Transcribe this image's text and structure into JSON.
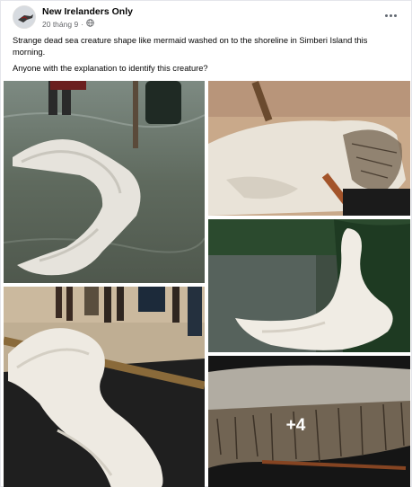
{
  "post": {
    "page_name": "New Irelanders Only",
    "date": "20 tháng 9",
    "separator": "·",
    "privacy_icon": "globe-icon",
    "more_icon": "more-options-icon",
    "text_line1": "Strange dead sea creature shape like mermaid washed on to the shoreline in Simberi Island this morning.",
    "text_line2": "Anyone with the explanation to identify this creature?"
  },
  "gallery": {
    "photo_count": 5,
    "more_count_label": "+4"
  }
}
